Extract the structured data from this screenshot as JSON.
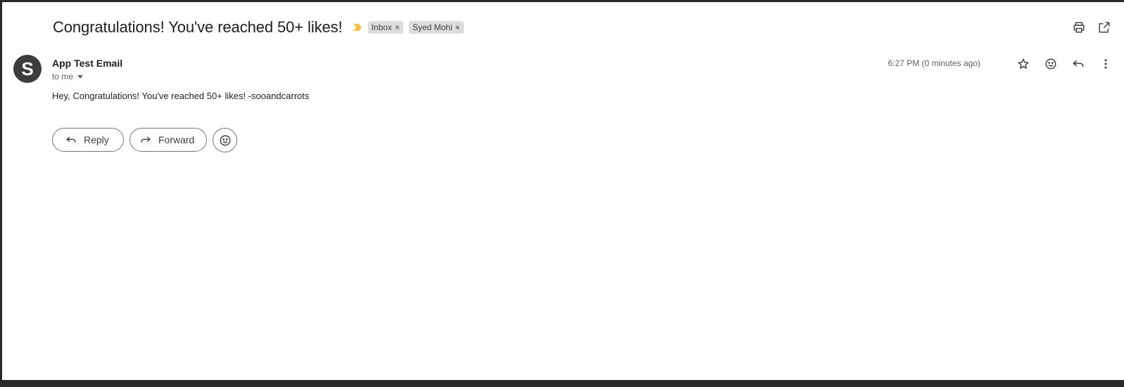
{
  "email": {
    "subject": "Congratulations! You've reached 50+ likes!",
    "labels": [
      {
        "name": "Inbox",
        "remove": "×"
      },
      {
        "name": "Syed Mohi",
        "remove": "×"
      }
    ],
    "importance_color": "#f6bf4f",
    "sender": {
      "avatar_letter": "S",
      "name": "App Test Email",
      "recipient_text": "to me"
    },
    "timestamp": "6:27 PM (0 minutes ago)",
    "body": "Hey, Congratulations! You've reached 50+ likes! -sooandcarrots",
    "actions": {
      "reply_label": "Reply",
      "forward_label": "Forward"
    }
  },
  "icons": {
    "top": [
      "print-icon",
      "open-in-new-window-icon"
    ],
    "message": [
      "star-icon",
      "emoji-icon",
      "reply-icon",
      "more-vert-icon"
    ]
  }
}
